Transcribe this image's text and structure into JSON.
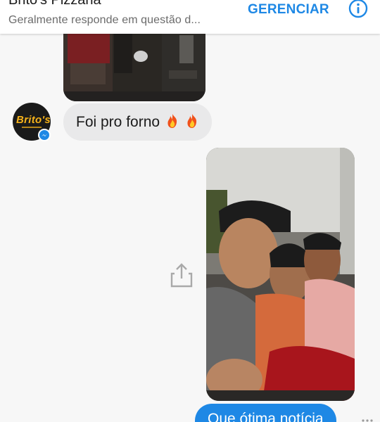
{
  "header": {
    "title": "Brito's Pizzaria",
    "subtitle": "Geralmente responde em questão d...",
    "manage_label": "GERENCIAR",
    "info_icon": "info-icon"
  },
  "avatar": {
    "logo_text": "Brito's",
    "badge_icon": "messenger-icon"
  },
  "messages": [
    {
      "direction": "incoming",
      "type": "image",
      "alt": ""
    },
    {
      "direction": "incoming",
      "type": "text",
      "text": "Foi pro forno"
    },
    {
      "direction": "outgoing",
      "type": "image",
      "alt": ""
    },
    {
      "direction": "outgoing",
      "type": "text",
      "text": "Que ótima notícia"
    }
  ],
  "icons": {
    "share": "share-icon",
    "fire": "fire-emoji"
  },
  "colors": {
    "accent": "#1e88e5",
    "incoming_bubble": "#e9e9ea",
    "background": "#f7f7f7"
  }
}
